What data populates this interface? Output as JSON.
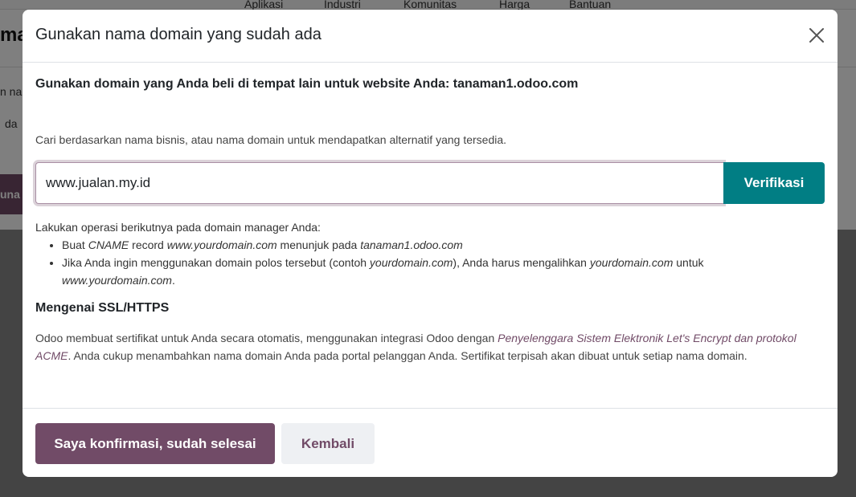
{
  "background": {
    "nav_items": [
      "Aplikasi",
      "Industri",
      "Komunitas",
      "Harga",
      "Bantuan"
    ],
    "heading_fragment": "ma",
    "line1_fragment": "n na",
    "line2_fragment": "da",
    "button_fragment": "una"
  },
  "modal": {
    "title": "Gunakan nama domain yang sudah ada",
    "subtitle": "Gunakan domain yang Anda beli di tempat lain untuk website Anda: tanaman1.odoo.com",
    "hint": "Cari berdasarkan nama bisnis, atau nama domain untuk mendapatkan alternatif yang tersedia.",
    "domain_value": "www.jualan.my.id",
    "verify_label": "Verifikasi",
    "instructions": {
      "intro": "Lakukan operasi berikutnya pada domain manager Anda:",
      "b1_prefix": "Buat ",
      "b1_cname": "CNAME",
      "b1_mid": " record ",
      "b1_domain": "www.yourdomain.com",
      "b1_mid2": " menunjuk pada ",
      "b1_target": "tanaman1.odoo.com",
      "b2_prefix": "Jika Anda ingin menggunakan domain polos tersebut (contoh ",
      "b2_example": "yourdomain.com",
      "b2_mid": "), Anda harus mengalihkan ",
      "b2_from": "yourdomain.com",
      "b2_mid2": " untuk ",
      "b2_to": "www.yourdomain.com",
      "b2_end": "."
    },
    "ssl": {
      "heading": "Mengenai SSL/HTTPS",
      "text_prefix": "Odoo membuat sertifikat untuk Anda secara otomatis, menggunakan integrasi Odoo dengan ",
      "link": "Penyelenggara Sistem Elektronik Let's Encrypt dan protokol ACME",
      "text_suffix": ". Anda cukup menambahkan nama domain Anda pada portal pelanggan Anda. Sertifikat terpisah akan dibuat untuk setiap nama domain."
    },
    "confirm_label": "Saya konfirmasi, sudah selesai",
    "back_label": "Kembali"
  }
}
